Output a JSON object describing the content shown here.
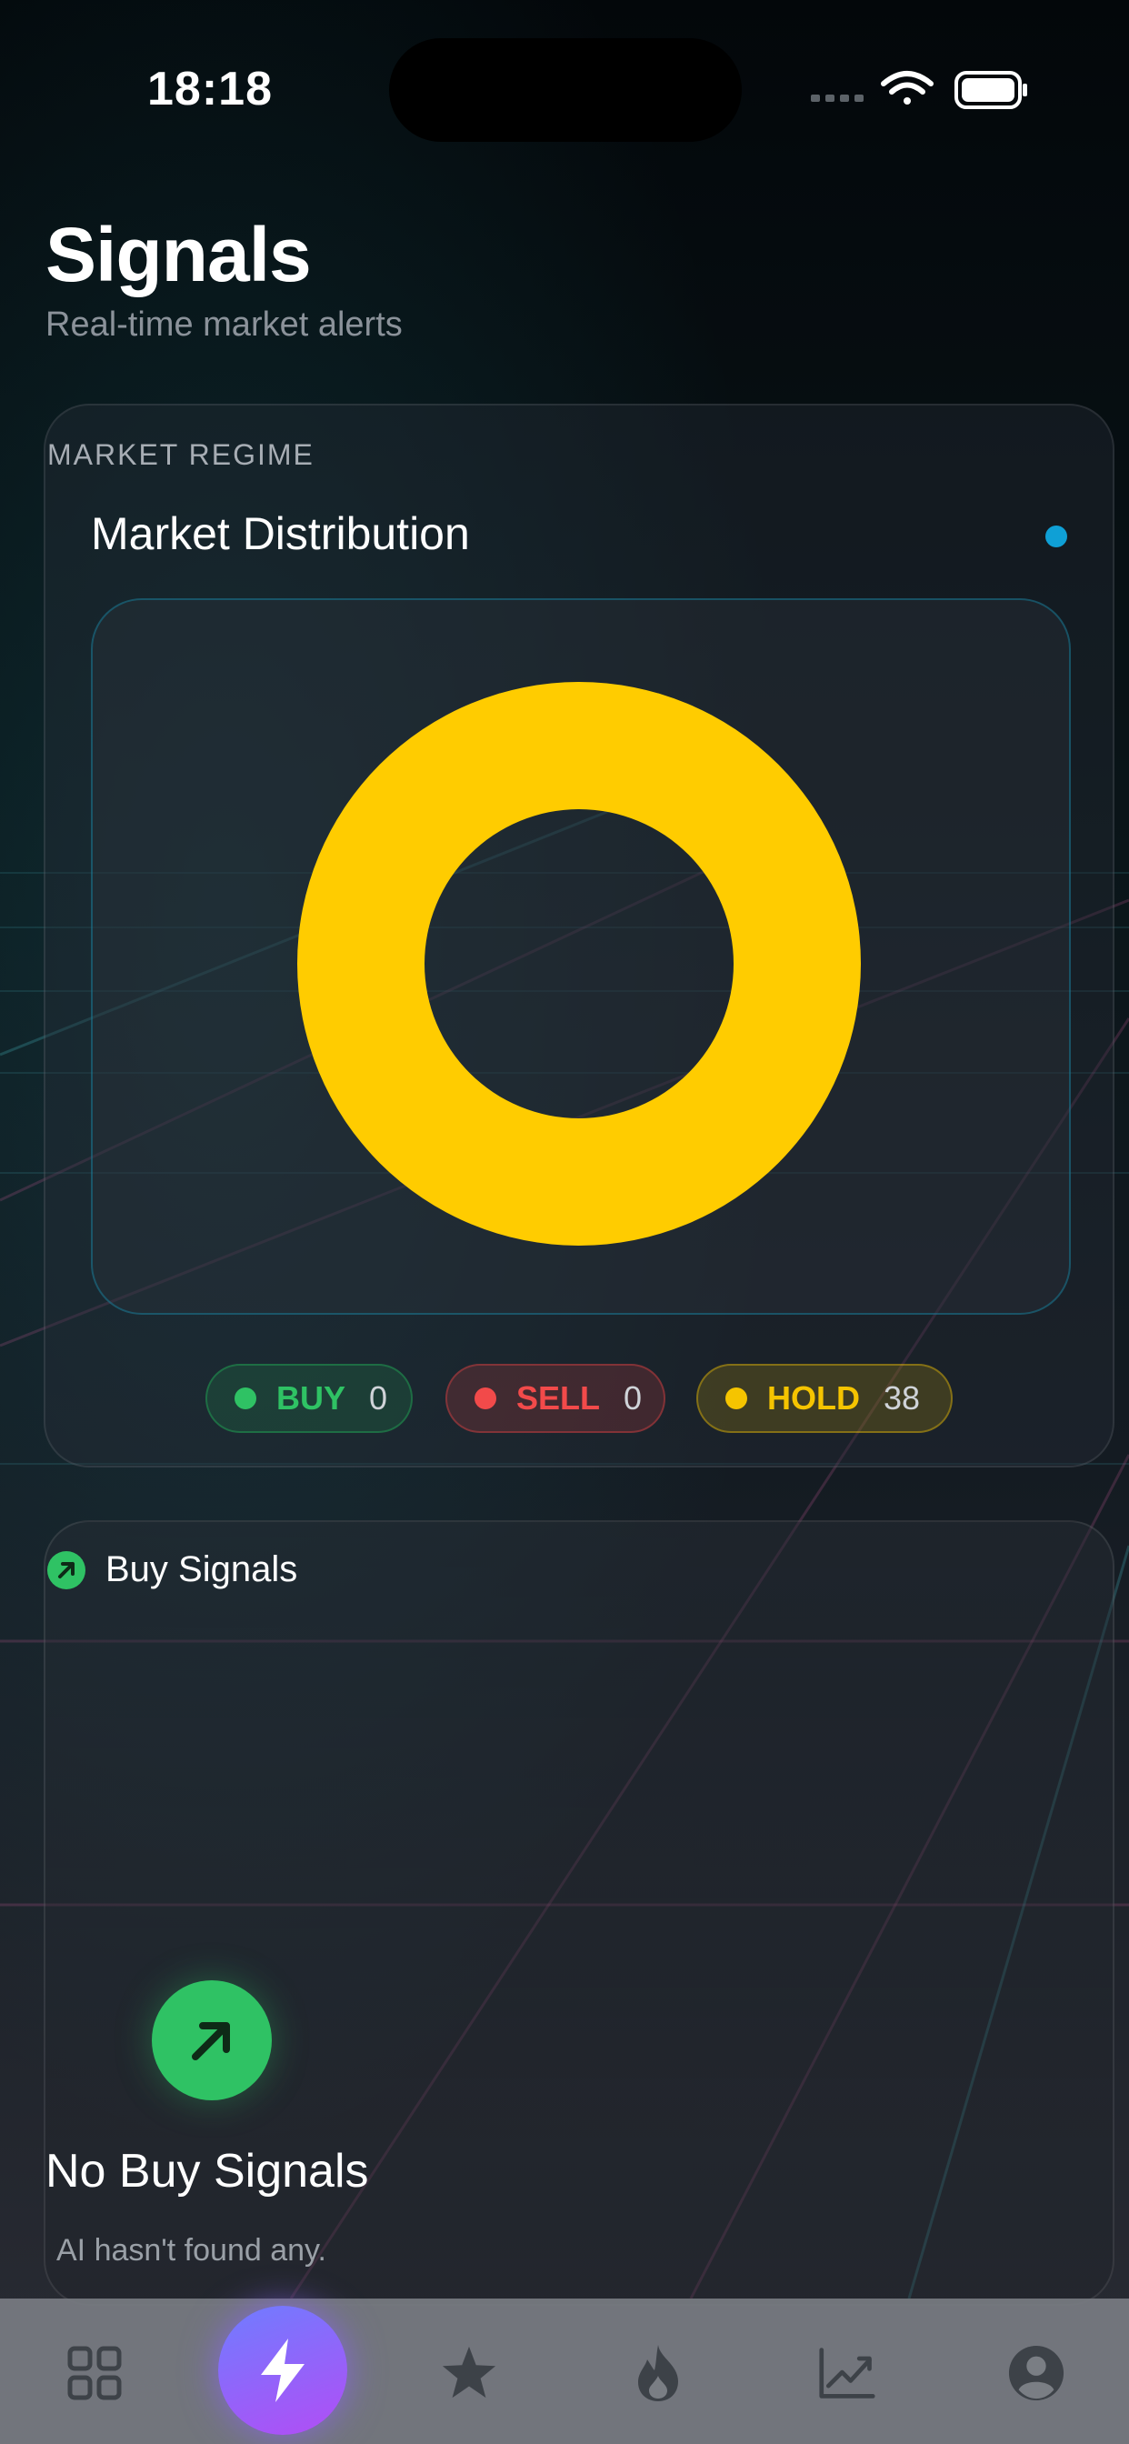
{
  "status_bar": {
    "time": "18:18"
  },
  "header": {
    "title": "Signals",
    "subtitle": "Real-time market alerts"
  },
  "market_regime": {
    "section_label": "MARKET REGIME",
    "title": "Market Distribution",
    "chart_data": {
      "type": "pie",
      "style": "donut",
      "categories": [
        "BUY",
        "SELL",
        "HOLD"
      ],
      "values": [
        0,
        0,
        38
      ],
      "colors": [
        "#2fc264",
        "#f24a4a",
        "#ffcc00"
      ]
    },
    "pills": [
      {
        "label": "BUY",
        "count": "0"
      },
      {
        "label": "SELL",
        "count": "0"
      },
      {
        "label": "HOLD",
        "count": "38"
      }
    ]
  },
  "buy_signals": {
    "title": "Buy Signals",
    "empty_title": "No Buy Signals",
    "empty_subtitle": "AI hasn't found any."
  },
  "tabbar": {
    "tabs": [
      {
        "icon": "grid-icon"
      },
      {
        "icon": "bolt-icon",
        "active": true
      },
      {
        "icon": "star-icon"
      },
      {
        "icon": "flame-icon"
      },
      {
        "icon": "chart-line-icon"
      },
      {
        "icon": "profile-icon"
      }
    ]
  }
}
